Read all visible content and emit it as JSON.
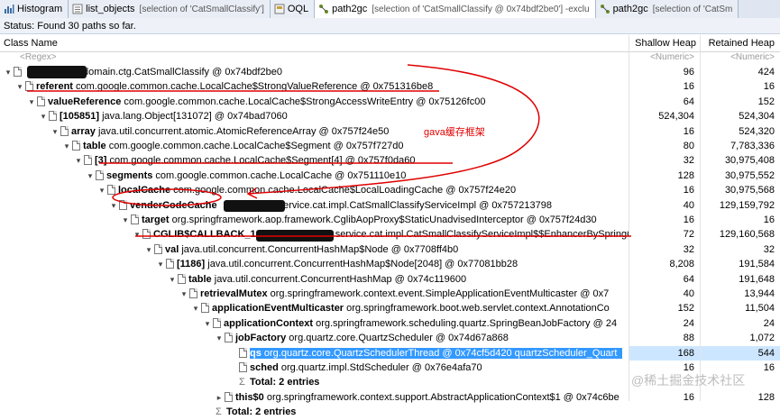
{
  "tabs": [
    {
      "name": "Histogram",
      "selection": ""
    },
    {
      "name": "list_objects",
      "selection": "[selection of 'CatSmallClassify']"
    },
    {
      "name": "OQL",
      "selection": ""
    },
    {
      "name": "path2gc",
      "selection": "[selection of 'CatSmallClassify @ 0x74bdf2be0'] -exclu"
    },
    {
      "name": "path2gc",
      "selection": "[selection of 'CatSm"
    }
  ],
  "status": "Status:  Found 30 paths so far.",
  "columns": {
    "class_name": "Class Name",
    "shallow": "Shallow Heap",
    "retained": "Retained Heap"
  },
  "filters": {
    "class_name": "<Regex>",
    "shallow": "<Numeric>",
    "retained": "<Numeric>"
  },
  "rows": [
    {
      "field": "",
      "text": ".domain.ctg.CatSmallClassify @ 0x74bdf2be0",
      "shallow": "96",
      "retained": "424"
    },
    {
      "field": "referent",
      "text": " com.google.common.cache.LocalCache$StrongValueReference @ 0x751316be8",
      "shallow": "16",
      "retained": "16"
    },
    {
      "field": "valueReference",
      "text": " com.google.common.cache.LocalCache$StrongAccessWriteEntry @ 0x75126fc00",
      "shallow": "64",
      "retained": "152"
    },
    {
      "field": "[105851]",
      "text": " java.lang.Object[131072] @ 0x74bad7060",
      "shallow": "524,304",
      "retained": "524,304"
    },
    {
      "field": "array",
      "text": " java.util.concurrent.atomic.AtomicReferenceArray @ 0x757f24e50",
      "shallow": "16",
      "retained": "524,320"
    },
    {
      "field": "table",
      "text": " com.google.common.cache.LocalCache$Segment @ 0x757f727d0",
      "shallow": "80",
      "retained": "7,783,336"
    },
    {
      "field": "[3]",
      "text": " com.google.common.cache.LocalCache$Segment[4] @ 0x757f0da60",
      "shallow": "32",
      "retained": "30,975,408"
    },
    {
      "field": "segments",
      "text": " com.google.common.cache.LocalCache @ 0x751110e10",
      "shallow": "128",
      "retained": "30,975,552"
    },
    {
      "field": "localCache",
      "text": " com.google.common.cache.LocalCache$LocalLoadingCache @ 0x757f24e20",
      "shallow": "16",
      "retained": "30,975,568"
    },
    {
      "field": "venderCodeCache",
      "text": "service.cat.impl.CatSmallClassifyServiceImpl @ 0x757213798",
      "shallow": "40",
      "retained": "129,159,792"
    },
    {
      "field": "target",
      "text": " org.springframework.aop.framework.CglibAopProxy$StaticUnadvisedInterceptor @ 0x757f24d30",
      "shallow": "16",
      "retained": "16"
    },
    {
      "field": "CGLIB$CALLBACK_1",
      "text": "service.cat.impl.CatSmallClassifyServiceImpl$$EnhancerBySpringCG",
      "shallow": "72",
      "retained": "129,160,568"
    },
    {
      "field": "val",
      "text": " java.util.concurrent.ConcurrentHashMap$Node @ 0x7708ff4b0",
      "shallow": "32",
      "retained": "32"
    },
    {
      "field": "[1186]",
      "text": " java.util.concurrent.ConcurrentHashMap$Node[2048] @ 0x77081bb28",
      "shallow": "8,208",
      "retained": "191,584"
    },
    {
      "field": "table",
      "text": " java.util.concurrent.ConcurrentHashMap @ 0x74c119600",
      "shallow": "64",
      "retained": "191,648"
    },
    {
      "field": "retrievalMutex",
      "text": " org.springframework.context.event.SimpleApplicationEventMulticaster @ 0x7",
      "shallow": "40",
      "retained": "13,944"
    },
    {
      "field": "applicationEventMulticaster",
      "text": " org.springframework.boot.web.servlet.context.AnnotationCo",
      "shallow": "152",
      "retained": "11,504"
    },
    {
      "field": "applicationContext",
      "text": " org.springframework.scheduling.quartz.SpringBeanJobFactory @ 24",
      "shallow": "24",
      "retained": "24"
    },
    {
      "field": "jobFactory",
      "text": " org.quartz.core.QuartzScheduler @ 0x74d67a868",
      "shallow": "88",
      "retained": "1,072"
    },
    {
      "field": "qs",
      "text": " org.quartz.core.QuartzSchedulerThread @ 0x74cf5d420  quartzScheduler_Quart",
      "shallow": "168",
      "retained": "544"
    },
    {
      "field": "sched",
      "text": " org.quartz.impl.StdScheduler @ 0x76e4afa70",
      "shallow": "16",
      "retained": "16"
    },
    {
      "field": "Total: 2 entries",
      "text": "",
      "shallow": "",
      "retained": ""
    },
    {
      "field": "this$0",
      "text": " org.springframework.context.support.AbstractApplicationContext$1 @ 0x74c6be",
      "shallow": "16",
      "retained": "128"
    },
    {
      "field": "Total: 2 entries",
      "text": "",
      "shallow": "",
      "retained": ""
    }
  ],
  "annotation": "gava缓存框架",
  "watermark": "@稀土掘金技术社区",
  "colors": {
    "selection": "#3399ff",
    "annotation": "#e00000"
  }
}
